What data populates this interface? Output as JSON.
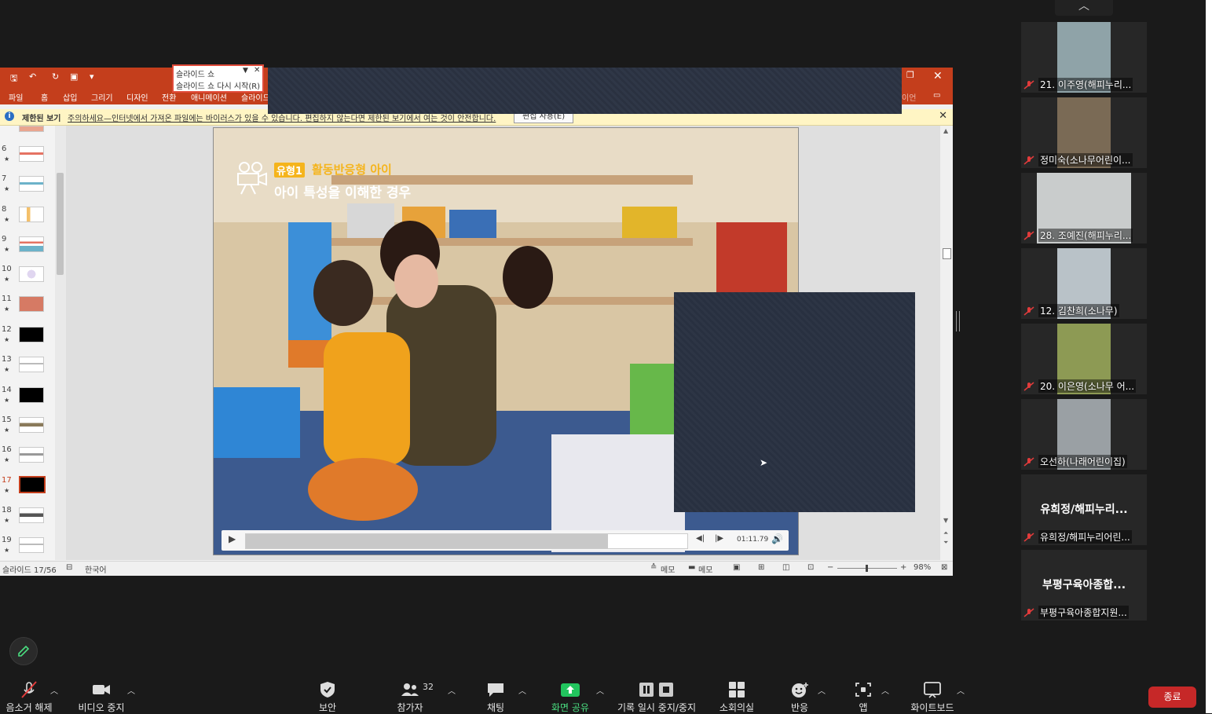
{
  "ppt": {
    "ribbon_tabs": [
      "파일",
      "홈",
      "삽입",
      "그리기",
      "디자인",
      "전환",
      "애니메이션",
      "슬라이드"
    ],
    "ribbon_right_fragment": "이언",
    "message_bar": {
      "title": "제한된 보기",
      "text": "주의하세요—인터넷에서 가져온 파일에는 바이러스가 있을 수 있습니다. 편집하지 않는다면 제한된 보기에서 여는 것이 안전합니다.",
      "button": "편집 사용(E)"
    },
    "thumbnails": [
      {
        "num": "6"
      },
      {
        "num": "7"
      },
      {
        "num": "8"
      },
      {
        "num": "9"
      },
      {
        "num": "10"
      },
      {
        "num": "11"
      },
      {
        "num": "12"
      },
      {
        "num": "13"
      },
      {
        "num": "14"
      },
      {
        "num": "15"
      },
      {
        "num": "16"
      },
      {
        "num": "17"
      },
      {
        "num": "18"
      },
      {
        "num": "19"
      }
    ],
    "slideshow_popup": {
      "title": "슬라이드 쇼",
      "restart": "슬라이드 쇼 다시 시작(R)"
    },
    "slide": {
      "badge": "유형1",
      "heading": "활동반응형 아이",
      "subheading": "아이 특성을 이해한 경우",
      "video_time": "01:11.79",
      "video_progress": 0.82
    },
    "status": {
      "slide_counter": "슬라이드 17/56",
      "language": "한국어",
      "notes1": "메모",
      "notes2": "메모",
      "zoom": "98%"
    }
  },
  "gallery": [
    {
      "name": "21. 이주영(해피누리...",
      "video": true,
      "bg": "#8fa3a8"
    },
    {
      "name": "정미숙(소나무어린이...",
      "video": true,
      "bg": "#7a6a55"
    },
    {
      "name": "28. 조예진(해피누리...",
      "video": true,
      "bg": "#c9cccc"
    },
    {
      "name": "12. 김찬희(소나무)",
      "video": true,
      "bg": "#b9c2c8"
    },
    {
      "name": "20. 이은영(소나무 어...",
      "video": true,
      "bg": "#8d9a54"
    },
    {
      "name": "오선하(나래어린이집)",
      "video": true,
      "bg": "#9aa0a4"
    },
    {
      "name": "유희정/해피누리어린...",
      "video": false,
      "display": "유희정/해피누리..."
    },
    {
      "name": "부평구육아종합지원...",
      "video": false,
      "display": "부평구육아종합..."
    }
  ],
  "toolbar": {
    "mute": "음소거 해제",
    "video": "비디오 중지",
    "security": "보안",
    "participants": "참가자",
    "participants_count": "32",
    "chat": "채팅",
    "share": "화면 공유",
    "pause_record": "기록 일시 중지/중지",
    "breakout": "소회의실",
    "reactions": "반응",
    "apps": "앱",
    "whiteboard": "화이트보드",
    "end": "종료",
    "share_color": "#22c55e",
    "end_color": "#c62828"
  }
}
